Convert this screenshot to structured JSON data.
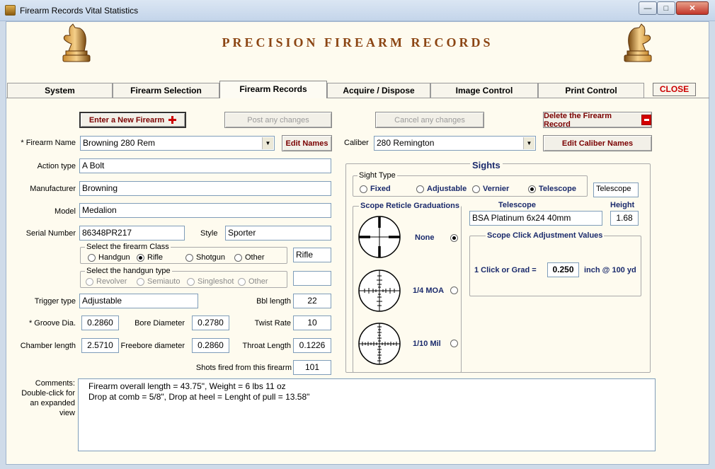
{
  "window": {
    "title": "Firearm Records Vital Statistics",
    "min_glyph": "—",
    "max_glyph": "□",
    "close_glyph": "✕"
  },
  "header": {
    "title": "PRECISION FIREARM RECORDS"
  },
  "tabs": [
    {
      "label": "System"
    },
    {
      "label": "Firearm Selection"
    },
    {
      "label": "Firearm Records"
    },
    {
      "label": "Acquire / Dispose"
    },
    {
      "label": "Image Control"
    },
    {
      "label": "Print Control"
    }
  ],
  "close_label": "CLOSE",
  "actions": {
    "enter_new": "Enter a New Firearm",
    "post_changes": "Post any changes",
    "cancel_changes": "Cancel any changes",
    "delete_record": "Delete the Firearm Record"
  },
  "firearm": {
    "name_label": "* Firearm Name",
    "name_value": "Browning 280 Rem",
    "edit_names": "Edit Names",
    "caliber_label": "Caliber",
    "caliber_value": "280 Remington",
    "edit_caliber": "Edit Caliber Names",
    "action_label": "Action type",
    "action_value": "A Bolt",
    "manufacturer_label": "Manufacturer",
    "manufacturer_value": "Browning",
    "model_label": "Model",
    "model_value": "Medalion",
    "serial_label": "Serial Number",
    "serial_value": "86348PR217",
    "style_label": "Style",
    "style_value": "Sporter",
    "class_group": "Select the firearm Class",
    "class_options": [
      "Handgun",
      "Rifle",
      "Shotgun",
      "Other"
    ],
    "class_value": "Rifle",
    "handgun_group": "Select the handgun type",
    "handgun_options": [
      "Revolver",
      "Semiauto",
      "Singleshot",
      "Other"
    ],
    "handgun_value": "",
    "trigger_label": "Trigger type",
    "trigger_value": "Adjustable",
    "bbl_label": "Bbl length",
    "bbl_value": "22",
    "groove_label": "* Groove Dia.",
    "groove_value": "0.2860",
    "bore_label": "Bore Diameter",
    "bore_value": "0.2780",
    "twist_label": "Twist Rate",
    "twist_value": "10",
    "chamber_label": "Chamber length",
    "chamber_value": "2.5710",
    "freebore_label": "Freebore diameter",
    "freebore_value": "0.2860",
    "throat_label": "Throat Length",
    "throat_value": "0.1226",
    "shots_label": "Shots fired from this firearm",
    "shots_value": "101"
  },
  "sights": {
    "title": "Sights",
    "type_group": "Sight Type",
    "type_options": [
      "Fixed",
      "Adjustable",
      "Vernier",
      "Telescope"
    ],
    "type_value": "Telescope",
    "reticle_group": "Scope Reticle Graduations",
    "reticle_options": [
      "None",
      "1/4 MOA",
      "1/10 Mil"
    ],
    "telescope_label": "Telescope",
    "telescope_value": "BSA Platinum 6x24 40mm",
    "height_label": "Height",
    "height_value": "1.68",
    "click_group": "Scope Click Adjustment Values",
    "click_prefix": "1  Click or Grad  =",
    "click_value": "0.250",
    "click_suffix": "inch @ 100 yd"
  },
  "comments": {
    "label": "Comments:\nDouble-click for\nan expanded\nview",
    "text": "Firearm overall length = 43.75\", Weight = 6 lbs 11 oz\nDrop at comb = 5/8\", Drop at heel =   Lenght of pull = 13.58\""
  },
  "colors": {
    "title_brown": "#8b4513",
    "navy": "#1a2a6c",
    "close_red": "#cc0000"
  }
}
